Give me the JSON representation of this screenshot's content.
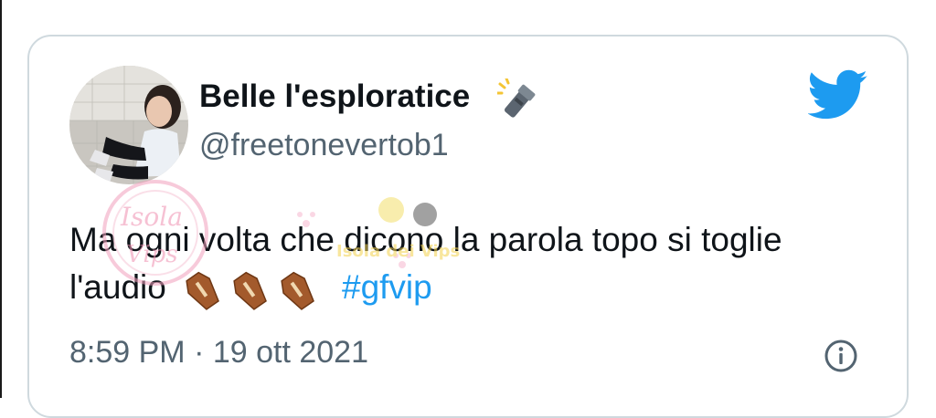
{
  "tweet": {
    "display_name": "Belle l'esploratice",
    "name_emoji": "flashlight-icon",
    "handle": "@freetonevertob1",
    "text_line1": "Ma ogni volta che dicono la parola topo si toglie",
    "text_line2": "l'audio",
    "text_emojis": [
      "coffin-icon",
      "coffin-icon",
      "coffin-icon"
    ],
    "hashtag": "#gfvip",
    "timestamp": "8:59 PM · 19 ott 2021"
  },
  "watermark": {
    "text": "Isola dei Vips"
  },
  "colors": {
    "brand": "#1d9bf0",
    "text": "#0f1419",
    "secondary": "#536471",
    "border": "#cfd9de"
  }
}
